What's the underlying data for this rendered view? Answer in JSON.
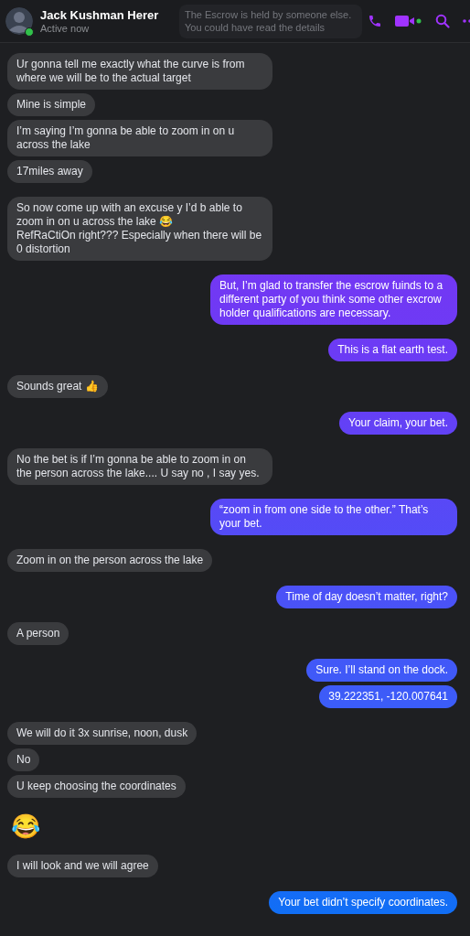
{
  "header": {
    "name": "Jack Kushman Herer",
    "status": "Active now",
    "online": true,
    "tooltip": "The Escrow is held by someone else. You could have read the details"
  },
  "groups": [
    {
      "kind": "received",
      "messages": [
        {
          "kind": "text",
          "text": "Ur gonna tell me exactly what the curve is from where we will be to the actual target"
        },
        {
          "kind": "text",
          "text": "Mine is simple"
        },
        {
          "kind": "text",
          "text": "I’m saying I’m gonna be able to zoom in on u across the lake"
        },
        {
          "kind": "text",
          "text": "17miles away"
        }
      ]
    },
    {
      "kind": "received",
      "messages": [
        {
          "kind": "text",
          "text": "So now come up with an excuse y I’d b able to zoom in on u across the lake 😂\nRefRaCtiOn right??? Especially when there will be 0 distortion"
        }
      ]
    },
    {
      "kind": "sent",
      "messages": [
        {
          "kind": "text",
          "text": "But, I’m glad to transfer the escrow fuinds to a different party of you think some other excrow holder qualifications are necessary."
        }
      ]
    },
    {
      "kind": "sent",
      "messages": [
        {
          "kind": "text",
          "text": "This is a flat earth test."
        }
      ]
    },
    {
      "kind": "received",
      "messages": [
        {
          "kind": "text",
          "text": "Sounds great 👍"
        }
      ]
    },
    {
      "kind": "sent",
      "messages": [
        {
          "kind": "text",
          "text": "Your claim, your bet."
        }
      ]
    },
    {
      "kind": "received",
      "messages": [
        {
          "kind": "text",
          "text": "No the bet is if I’m gonna be able to zoom in on the person across the lake.... U say no , I say yes."
        }
      ]
    },
    {
      "kind": "sent",
      "messages": [
        {
          "kind": "text",
          "text": "“zoom in from one side to the other.”  That’s your bet."
        }
      ]
    },
    {
      "kind": "received",
      "messages": [
        {
          "kind": "text",
          "text": "Zoom in on the person across the lake"
        }
      ]
    },
    {
      "kind": "sent",
      "messages": [
        {
          "kind": "text",
          "text": "Time of day doesn’t matter, right?"
        }
      ]
    },
    {
      "kind": "received",
      "messages": [
        {
          "kind": "text",
          "text": "A person"
        }
      ]
    },
    {
      "kind": "sent",
      "messages": [
        {
          "kind": "text",
          "text": "Sure.  I’ll stand on the dock."
        },
        {
          "kind": "text",
          "text": "39.222351, -120.007641"
        }
      ]
    },
    {
      "kind": "received",
      "messages": [
        {
          "kind": "text",
          "text": "We will do it 3x sunrise, noon, dusk"
        },
        {
          "kind": "text",
          "text": "No"
        },
        {
          "kind": "text",
          "text": "U keep choosing the coordinates"
        }
      ]
    },
    {
      "kind": "received",
      "messages": [
        {
          "kind": "emoji",
          "text": "😂"
        }
      ]
    },
    {
      "kind": "received",
      "messages": [
        {
          "kind": "text",
          "text": "I will look and we will agree"
        }
      ]
    },
    {
      "kind": "sent",
      "messages": [
        {
          "kind": "text",
          "text": "Your bet didn’t specify coordinates."
        }
      ]
    }
  ]
}
